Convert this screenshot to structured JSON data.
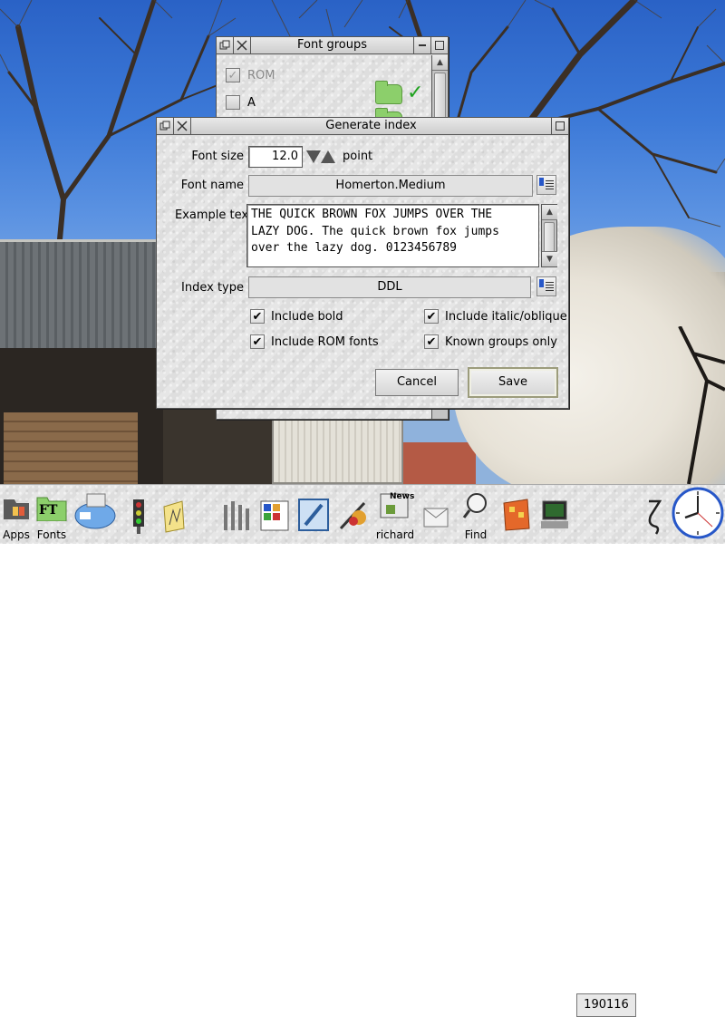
{
  "font_groups": {
    "title": "Font groups",
    "rows": [
      {
        "label": "ROM",
        "checked": true,
        "dimmed": true,
        "tick": "✓"
      },
      {
        "label": "A",
        "checked": false,
        "dimmed": false
      }
    ]
  },
  "generate_index": {
    "title": "Generate index",
    "font_size_label": "Font size",
    "font_size_value": "12.0",
    "font_size_unit": "point",
    "font_name_label": "Font name",
    "font_name_value": "Homerton.Medium",
    "example_text_label": "Example text",
    "example_text_lines": [
      "THE QUICK BROWN FOX JUMPS OVER THE",
      "LAZY DOG. The quick brown fox jumps",
      "over the lazy dog. 0123456789"
    ],
    "index_type_label": "Index type",
    "index_type_value": "DDL",
    "options": {
      "include_bold": "Include bold",
      "include_italic": "Include italic/oblique",
      "include_rom": "Include ROM fonts",
      "known_groups": "Known groups only"
    },
    "cancel_label": "Cancel",
    "save_label": "Save"
  },
  "iconbar": {
    "apps_label": "Apps",
    "fonts_label": "Fonts",
    "fonts_badge": "FT",
    "richard_label": "richard",
    "news_badge": "News",
    "find_label": "Find",
    "clock_text": "190116"
  },
  "colors": {
    "folder": "#8ccf6b",
    "tick": "#1fa21f",
    "accent_blue": "#2757c8"
  }
}
